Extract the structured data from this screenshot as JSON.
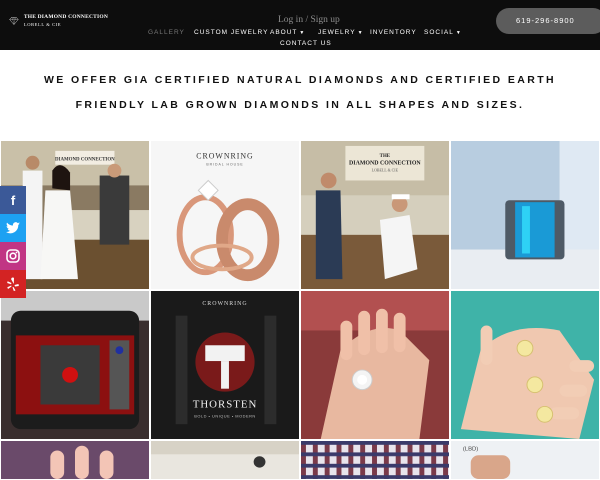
{
  "header": {
    "logo_line1": "THE DIAMOND CONNECTION",
    "logo_line2": "LOBELL & CIE",
    "login": "Log in / Sign up",
    "phone": "619-296-8900"
  },
  "nav": {
    "items": [
      {
        "label": "GALLERY",
        "active": true
      },
      {
        "label": "CUSTOM JEWELRY"
      },
      {
        "label": "ABOUT"
      },
      {
        "label": "JEWELRY"
      },
      {
        "label": "INVENTORY"
      },
      {
        "label": "SOCIAL"
      },
      {
        "label": "CONTACT US"
      }
    ]
  },
  "headline": "WE OFFER GIA CERTIFIED NATURAL DIAMONDS AND CERTIFIED EARTH FRIENDLY LAB GROWN DIAMONDS IN ALL SHAPES AND SIZES.",
  "gallery": {
    "tile2_brand": "CROWNRING",
    "tile2_sub": "BRIDAL HOUSE",
    "tile3_sign1": "THE",
    "tile3_sign2": "DIAMOND CONNECTION",
    "tile3_sign3": "LOBELL & CIE",
    "tile1_sign": "DIAMOND CONNECTION",
    "tile6_brand": "CROWNRING",
    "tile6_logo": "THORSTEN",
    "tile6_tag": "BOLD • UNIQUE • MODERN",
    "tile11_note": "(LBD)"
  },
  "social": [
    {
      "name": "facebook-icon",
      "glyph": "f"
    },
    {
      "name": "twitter-icon",
      "glyph": ""
    },
    {
      "name": "instagram-icon",
      "glyph": ""
    },
    {
      "name": "yelp-icon",
      "glyph": ""
    }
  ],
  "colors": {
    "header_bg": "#0d0d0d",
    "phone_pill": "#5c5c5c",
    "facebook": "#3b5998",
    "twitter": "#1da1f2",
    "instagram": "#c13584",
    "yelp": "#d32323"
  }
}
